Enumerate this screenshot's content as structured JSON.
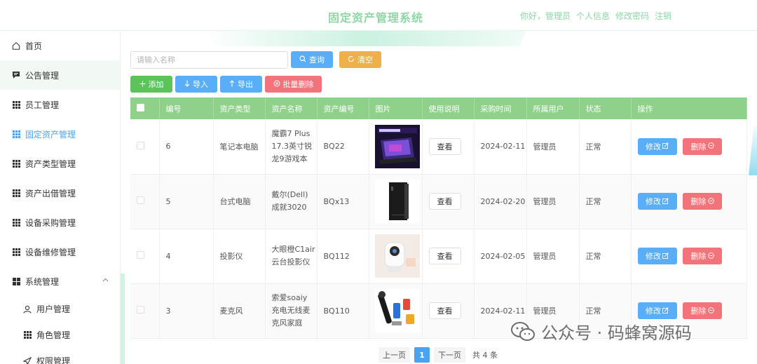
{
  "header": {
    "title": "固定资产管理系统",
    "greeting": "你好，管理员",
    "profile": "个人信息",
    "change_password": "修改密码",
    "logout": "注销"
  },
  "sidebar": {
    "items": [
      {
        "label": "首页",
        "icon": "home-icon"
      },
      {
        "label": "公告管理",
        "icon": "notice-icon"
      },
      {
        "label": "员工管理",
        "icon": "grid-icon"
      },
      {
        "label": "固定资产管理",
        "icon": "grid-icon"
      },
      {
        "label": "资产类型管理",
        "icon": "grid-icon"
      },
      {
        "label": "资产出借管理",
        "icon": "grid-icon"
      },
      {
        "label": "设备采购管理",
        "icon": "grid-icon"
      },
      {
        "label": "设备维修管理",
        "icon": "grid-icon"
      },
      {
        "label": "系统管理",
        "icon": "apps-icon"
      },
      {
        "label": "用户管理",
        "icon": "user-icon"
      },
      {
        "label": "角色管理",
        "icon": "grid-icon"
      },
      {
        "label": "权限管理",
        "icon": "send-icon"
      }
    ]
  },
  "toolbar": {
    "search_placeholder": "请输入名称",
    "search_label": "查询",
    "clear_label": "清空",
    "add_label": "添加",
    "import_label": "导入",
    "export_label": "导出",
    "batch_delete_label": "批量删除"
  },
  "table": {
    "columns": [
      "编号",
      "资产类型",
      "资产名称",
      "资产编号",
      "图片",
      "使用说明",
      "采购时间",
      "所属用户",
      "状态",
      "操作"
    ],
    "view_label": "查看",
    "edit_label": "修改",
    "delete_label": "删除",
    "rows": [
      {
        "id": "6",
        "type": "笔记本电脑",
        "name_lines": [
          "魔霸7 Plus",
          "17.3英寸锐",
          "龙9游戏本"
        ],
        "code": "BQ22",
        "date": "2024-02-11",
        "owner": "管理员",
        "status": "正常",
        "image": "gaming-laptop-image"
      },
      {
        "id": "5",
        "type": "台式电脑",
        "name_lines": [
          "戴尔(Dell)",
          "成就3020"
        ],
        "code": "BQx13",
        "date": "2024-02-20",
        "owner": "管理员",
        "status": "正常",
        "image": "desktop-pc-image"
      },
      {
        "id": "4",
        "type": "投影仪",
        "name_lines": [
          "大眼橙C1air",
          "云台投影仪"
        ],
        "code": "BQ112",
        "date": "2024-02-05",
        "owner": "管理员",
        "status": "正常",
        "image": "projector-image"
      },
      {
        "id": "3",
        "type": "麦克风",
        "name_lines": [
          "索爱soaiy",
          "充电无线麦",
          "克风家庭"
        ],
        "code": "BQ110",
        "date": "2024-02-11",
        "owner": "管理员",
        "status": "正常",
        "image": "microphone-image"
      }
    ]
  },
  "pagination": {
    "prev_label": "上一页",
    "current_page": "1",
    "next_label": "下一页",
    "total_label": "共 4 条"
  },
  "watermark": {
    "text": "公众号 · 码蜂窝源码"
  },
  "colors": {
    "header_accent": "#8fd6a6",
    "table_header": "#8fd18b",
    "primary": "#5aaef7",
    "danger": "#f2737a",
    "warning": "#eeb04a",
    "success": "#5cc25a"
  }
}
